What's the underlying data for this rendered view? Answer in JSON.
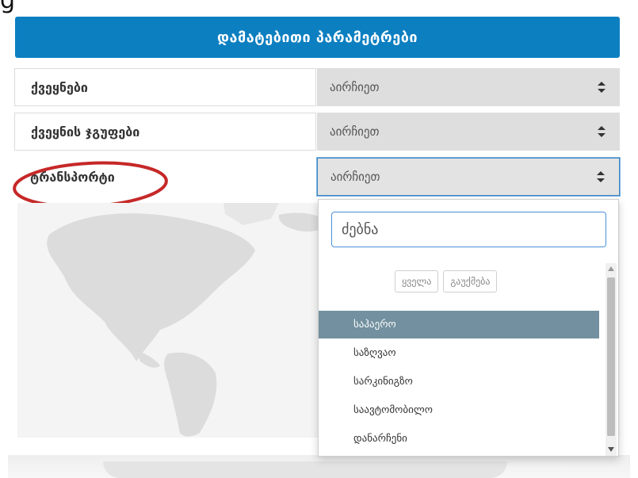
{
  "top_heading": "g",
  "panel": {
    "title": "დამატებითი პარამეტრები"
  },
  "rows": [
    {
      "label": "ქვეყნები",
      "select_value": "აირჩიეთ"
    },
    {
      "label": "ქვეყნის ჯგუფები",
      "select_value": "აირჩიეთ"
    },
    {
      "label": "ტრანსპორტი",
      "select_value": "აირჩიეთ"
    }
  ],
  "dropdown": {
    "search_placeholder": "ძებნა",
    "select_all_label": "ყველა",
    "deselect_all_label": "გაუქმება",
    "options": [
      "საჰაერო",
      "საზღვაო",
      "სარკინიგზო",
      "საავტომობილო",
      "დანარჩენი"
    ],
    "selected_option": "საჰაერო"
  },
  "colors": {
    "header_blue": "#0c7fc1",
    "selected_option_bg": "#72909f",
    "highlight_ellipse": "#c62828",
    "select_bg": "#dedede"
  },
  "icons": {
    "select_arrow": "sort-icon",
    "highlight": "red-ellipse"
  }
}
